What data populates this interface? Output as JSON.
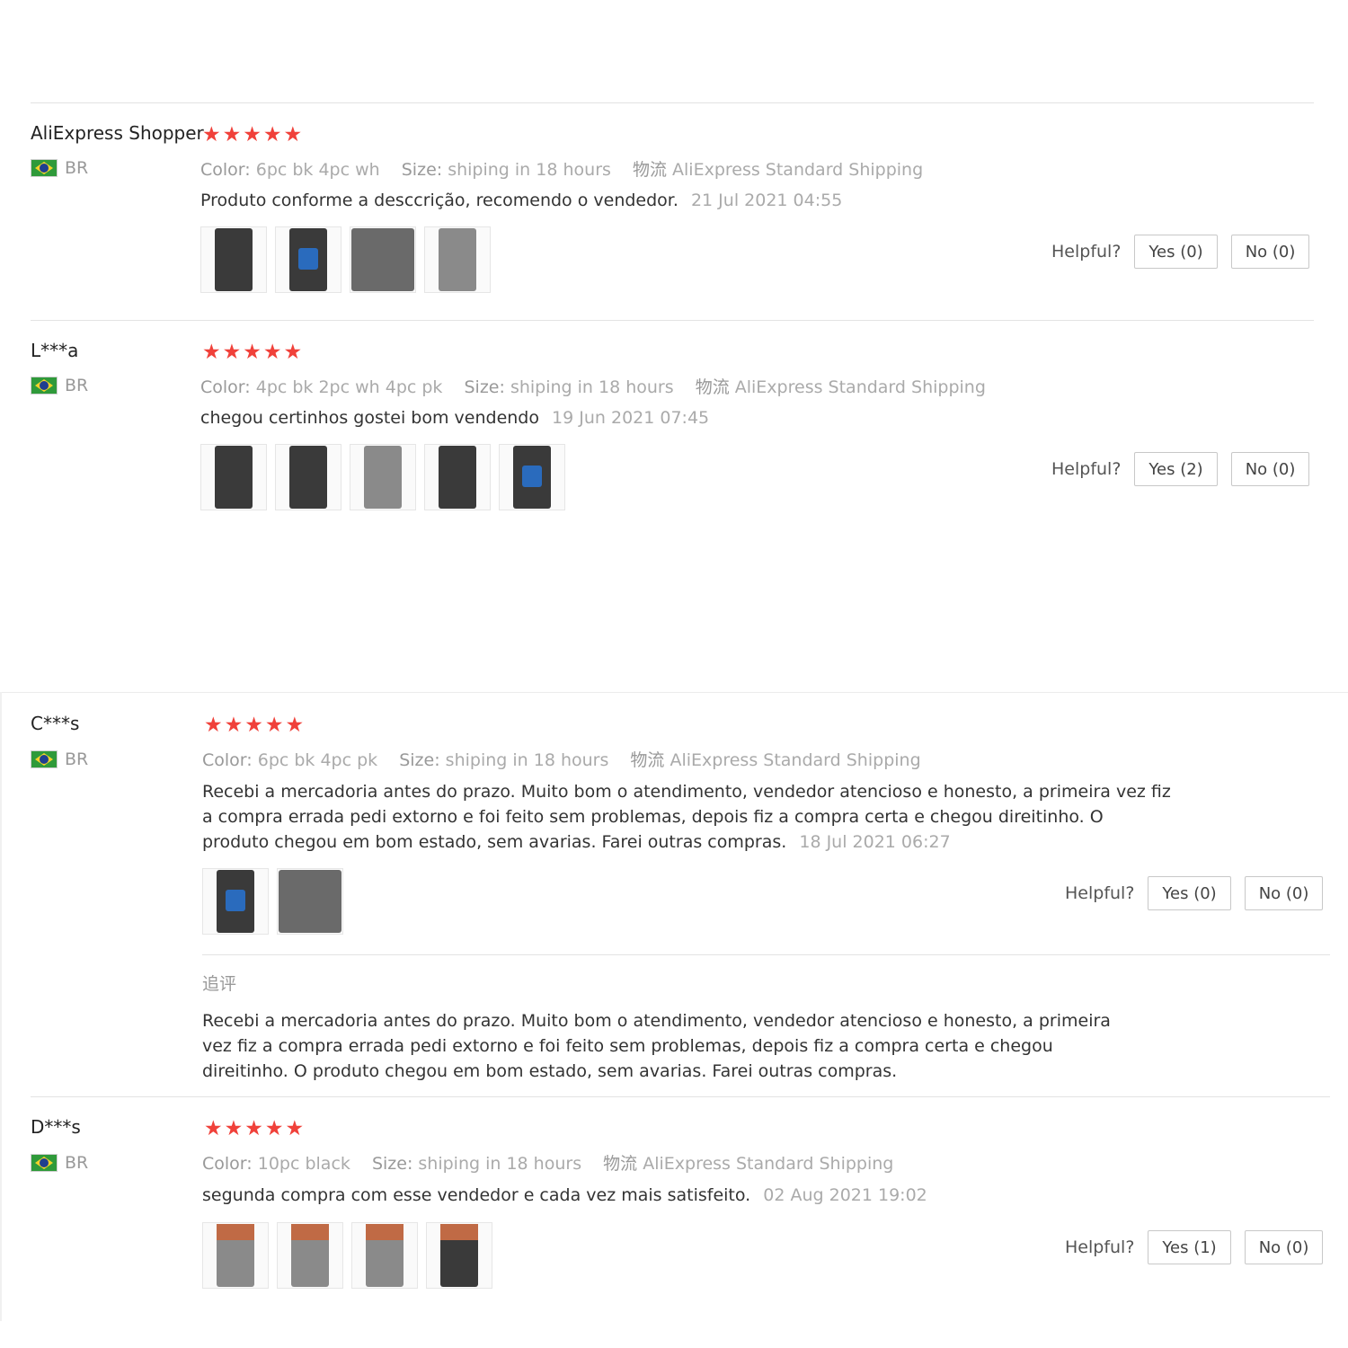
{
  "helpful_label": "Helpful?",
  "color_key": "Color:",
  "size_key": "Size:",
  "shipping_key": "物流",
  "reviews": [
    {
      "user": "AliExpress Shopper",
      "country": "BR",
      "stars": "★★★★★",
      "color": "6pc bk 4pc wh",
      "size": "shiping in 18 hours",
      "shipping": "AliExpress Standard Shipping",
      "text": "Produto conforme a desccrição, recomendo o vendedor.",
      "date": "21 Jul 2021 04:55",
      "yes": "Yes (0)",
      "no": "No (0)"
    },
    {
      "user": "L***a",
      "country": "BR",
      "stars": "★★★★★",
      "color": "4pc bk 2pc wh 4pc pk",
      "size": "shiping in 18 hours",
      "shipping": "AliExpress Standard Shipping",
      "text": "chegou certinhos gostei bom vendendo",
      "date": "19 Jun 2021 07:45",
      "yes": "Yes (2)",
      "no": "No (0)"
    },
    {
      "user": "C***s",
      "country": "BR",
      "stars": "★★★★★",
      "color": "6pc bk 4pc pk",
      "size": "shiping in 18 hours",
      "shipping": "AliExpress Standard Shipping",
      "text": "Recebi a mercadoria antes do prazo. Muito bom o atendimento, vendedor atencioso e honesto, a primeira vez fiz a compra errada pedi extorno e foi feito sem problemas, depois fiz a compra certa e chegou direitinho. O produto chegou em bom estado, sem avarias. Farei outras compras.",
      "date": "18 Jul 2021 06:27",
      "yes": "Yes (0)",
      "no": "No (0)",
      "additional_label": "追评",
      "additional_text": "Recebi a mercadoria antes do prazo. Muito bom o atendimento, vendedor atencioso e honesto, a primeira vez fiz a compra errada pedi extorno e foi feito sem problemas, depois fiz a compra certa e chegou direitinho. O produto chegou em bom estado, sem avarias. Farei outras compras."
    },
    {
      "user": "D***s",
      "country": "BR",
      "stars": "★★★★★",
      "color": "10pc black",
      "size": "shiping in 18 hours",
      "shipping": "AliExpress Standard Shipping",
      "text": "segunda compra com esse vendedor e cada vez mais satisfeito.",
      "date": "02 Aug 2021 19:02",
      "yes": "Yes (1)",
      "no": "No (0)"
    }
  ]
}
